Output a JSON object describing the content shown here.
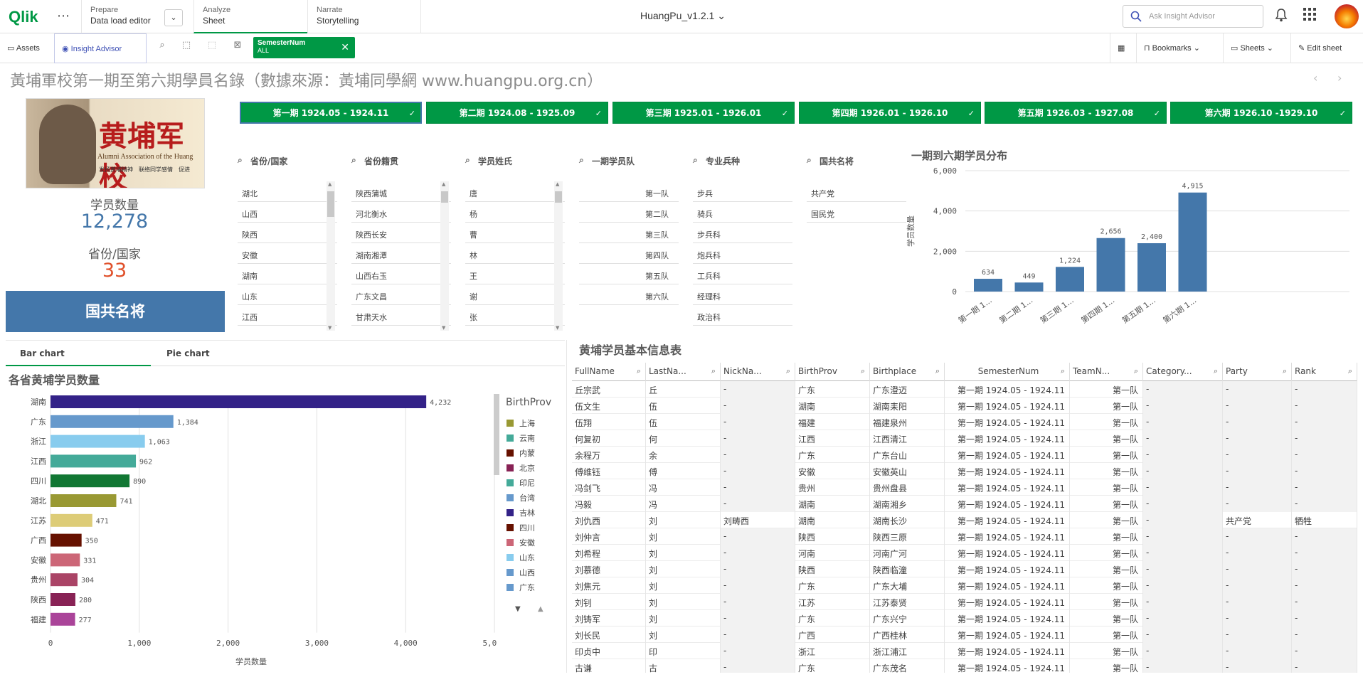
{
  "topbar": {
    "logo": "Qlik",
    "prepare_k": "Prepare",
    "prepare_v": "Data load editor",
    "analyze_k": "Analyze",
    "analyze_v": "Sheet",
    "narrate_k": "Narrate",
    "narrate_v": "Storytelling",
    "app_title": "HuangPu_v1.2.1",
    "search_placeholder": "Ask Insight Advisor"
  },
  "toolbar": {
    "assets": "Assets",
    "insight": "Insight Advisor",
    "sel_field": "SemesterNum",
    "sel_value": "ALL",
    "bookmarks": "Bookmarks",
    "sheets": "Sheets",
    "edit": "Edit sheet"
  },
  "sheet": {
    "title": "黃埔軍校第一期至第六期學員名錄（數據來源：黃埔同學網 www.huangpu.org.cn）"
  },
  "image": {
    "logo_text": "黄埔军校",
    "sub_text": "Alumni Association of the Huang",
    "sub2_text": "发扬黄埔精神　联络同学感情　促进"
  },
  "kpi": {
    "students_label": "学员数量",
    "students_value": "12,278",
    "prov_label": "省份/国家",
    "prov_value": "33",
    "gc_button": "国共名将"
  },
  "periods": [
    "第一期 1924.05 - 1924.11",
    "第二期 1924.08 - 1925.09",
    "第三期 1925.01 - 1926.01",
    "第四期 1926.01 - 1926.10",
    "第五期 1926.03 - 1927.08",
    "第六期 1926.10 -1929.10"
  ],
  "filters": [
    {
      "title": "省份/国家",
      "items": [
        "湖北",
        "山西",
        "陕西",
        "安徽",
        "湖南",
        "山东",
        "江西"
      ]
    },
    {
      "title": "省份籍贯",
      "items": [
        "陕西蒲城",
        "河北衡水",
        "陕西长安",
        "湖南湘潭",
        "山西右玉",
        "广东文昌",
        "甘肃天水"
      ]
    },
    {
      "title": "学员姓氏",
      "items": [
        "唐",
        "杨",
        "曹",
        "林",
        "王",
        "谢",
        "张"
      ]
    },
    {
      "title": "一期学员队",
      "items": [
        "第一队",
        "第二队",
        "第三队",
        "第四队",
        "第五队",
        "第六队"
      ]
    },
    {
      "title": "专业兵种",
      "items": [
        "步兵",
        "骑兵",
        "步兵科",
        "炮兵科",
        "工兵科",
        "经理科",
        "政治科"
      ]
    },
    {
      "title": "国共名将",
      "items": [
        "共产党",
        "国民党"
      ]
    }
  ],
  "distribution_chart": {
    "title": "一期到六期学员分布"
  },
  "province_chart": {
    "title": "各省黄埔学员数量"
  },
  "tabs": {
    "bar": "Bar chart",
    "pie": "Pie chart"
  },
  "legend": {
    "title": "BirthProv",
    "items": [
      {
        "name": "上海",
        "color": "#999933"
      },
      {
        "name": "云南",
        "color": "#44aa99"
      },
      {
        "name": "内蒙",
        "color": "#661100"
      },
      {
        "name": "北京",
        "color": "#882255"
      },
      {
        "name": "印尼",
        "color": "#44aa99"
      },
      {
        "name": "台湾",
        "color": "#6699cc"
      },
      {
        "name": "吉林",
        "color": "#332288"
      },
      {
        "name": "四川",
        "color": "#661100"
      },
      {
        "name": "安徽",
        "color": "#cc6677"
      },
      {
        "name": "山东",
        "color": "#88ccee"
      },
      {
        "name": "山西",
        "color": "#6699cc"
      },
      {
        "name": "广东",
        "color": "#6699cc"
      }
    ]
  },
  "table": {
    "title": "黄埔学员基本信息表",
    "columns": [
      "FullName",
      "LastNa...",
      "NickNa...",
      "BirthProv",
      "Birthplace",
      "SemesterNum",
      "TeamN...",
      "Category...",
      "Party",
      "Rank"
    ],
    "rows": [
      [
        "丘宗武",
        "丘",
        "-",
        "广东",
        "广东澄迈",
        "第一期 1924.05 - 1924.11",
        "第一队",
        "-",
        "-",
        "-"
      ],
      [
        "伍文生",
        "伍",
        "-",
        "湖南",
        "湖南耒阳",
        "第一期 1924.05 - 1924.11",
        "第一队",
        "-",
        "-",
        "-"
      ],
      [
        "伍翔",
        "伍",
        "-",
        "福建",
        "福建泉州",
        "第一期 1924.05 - 1924.11",
        "第一队",
        "-",
        "-",
        "-"
      ],
      [
        "何复初",
        "何",
        "-",
        "江西",
        "江西清江",
        "第一期 1924.05 - 1924.11",
        "第一队",
        "-",
        "-",
        "-"
      ],
      [
        "余程万",
        "余",
        "-",
        "广东",
        "广东台山",
        "第一期 1924.05 - 1924.11",
        "第一队",
        "-",
        "-",
        "-"
      ],
      [
        "傅维钰",
        "傅",
        "-",
        "安徽",
        "安徽英山",
        "第一期 1924.05 - 1924.11",
        "第一队",
        "-",
        "-",
        "-"
      ],
      [
        "冯剑飞",
        "冯",
        "-",
        "贵州",
        "贵州盘县",
        "第一期 1924.05 - 1924.11",
        "第一队",
        "-",
        "-",
        "-"
      ],
      [
        "冯毅",
        "冯",
        "-",
        "湖南",
        "湖南湘乡",
        "第一期 1924.05 - 1924.11",
        "第一队",
        "-",
        "-",
        "-"
      ],
      [
        "刘仇西",
        "刘",
        "刘畴西",
        "湖南",
        "湖南长沙",
        "第一期 1924.05 - 1924.11",
        "第一队",
        "-",
        "共产党",
        "牺牲"
      ],
      [
        "刘仲言",
        "刘",
        "-",
        "陕西",
        "陕西三原",
        "第一期 1924.05 - 1924.11",
        "第一队",
        "-",
        "-",
        "-"
      ],
      [
        "刘希程",
        "刘",
        "-",
        "河南",
        "河南广河",
        "第一期 1924.05 - 1924.11",
        "第一队",
        "-",
        "-",
        "-"
      ],
      [
        "刘慕德",
        "刘",
        "-",
        "陕西",
        "陕西临潼",
        "第一期 1924.05 - 1924.11",
        "第一队",
        "-",
        "-",
        "-"
      ],
      [
        "刘焦元",
        "刘",
        "-",
        "广东",
        "广东大埔",
        "第一期 1924.05 - 1924.11",
        "第一队",
        "-",
        "-",
        "-"
      ],
      [
        "刘钊",
        "刘",
        "-",
        "江苏",
        "江苏泰贤",
        "第一期 1924.05 - 1924.11",
        "第一队",
        "-",
        "-",
        "-"
      ],
      [
        "刘铸军",
        "刘",
        "-",
        "广东",
        "广东兴宁",
        "第一期 1924.05 - 1924.11",
        "第一队",
        "-",
        "-",
        "-"
      ],
      [
        "刘长民",
        "刘",
        "-",
        "广西",
        "广西桂林",
        "第一期 1924.05 - 1924.11",
        "第一队",
        "-",
        "-",
        "-"
      ],
      [
        "印贞中",
        "印",
        "-",
        "浙江",
        "浙江浦江",
        "第一期 1924.05 - 1924.11",
        "第一队",
        "-",
        "-",
        "-"
      ],
      [
        "古谦",
        "古",
        "-",
        "广东",
        "广东茂名",
        "第一期 1924.05 - 1924.11",
        "第一队",
        "-",
        "-",
        "-"
      ]
    ]
  },
  "chart_data": [
    {
      "type": "bar",
      "title": "一期到六期学员分布",
      "categories": [
        "第一期 1...",
        "第二期 1...",
        "第三期 1...",
        "第四期 1...",
        "第五期 1...",
        "第六期 1..."
      ],
      "values": [
        634,
        449,
        1224,
        2656,
        2400,
        4915
      ],
      "ylabel": "学员数量",
      "xlabel": "",
      "ylim": [
        0,
        6000
      ],
      "yticks": [
        "0",
        "2,000",
        "4,000",
        "6,000"
      ],
      "color": "#4477aa",
      "grid": true
    },
    {
      "type": "bar",
      "orientation": "horizontal",
      "title": "各省黄埔学员数量",
      "categories": [
        "湖南",
        "广东",
        "浙江",
        "江西",
        "四川",
        "湖北",
        "江苏",
        "广西",
        "安徽",
        "贵州",
        "陕西",
        "福建"
      ],
      "values": [
        4232,
        1384,
        1063,
        962,
        890,
        741,
        471,
        350,
        331,
        304,
        280,
        277
      ],
      "colors": [
        "#332288",
        "#6699cc",
        "#88ccee",
        "#44aa99",
        "#117733",
        "#999933",
        "#ddcc77",
        "#661100",
        "#cc6677",
        "#aa4466",
        "#882255",
        "#aa4499"
      ],
      "xlabel": "学员数量",
      "xlim": [
        0,
        5000
      ],
      "xticks": [
        "0",
        "1,000",
        "2,000",
        "3,000",
        "4,000",
        "5,000"
      ],
      "grid": true
    }
  ]
}
